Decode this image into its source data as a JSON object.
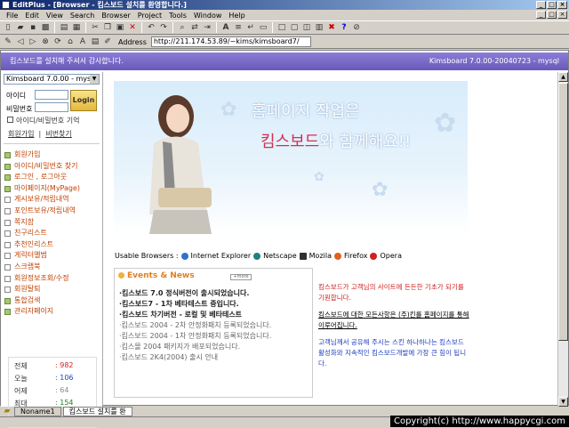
{
  "window": {
    "title": "EditPlus - [Browser - 킴스보드 설치를 환영합니다.]"
  },
  "menu": [
    "File",
    "Edit",
    "View",
    "Search",
    "Browser",
    "Project",
    "Tools",
    "Window",
    "Help"
  ],
  "address": {
    "label": "Address",
    "url": "http://211.174.53.89/~kims/kimsboard7/"
  },
  "topbar": {
    "left": "킴스보드를 설치해 주셔서 감사합니다.",
    "right": "Kimsboard 7.0.00-20040723 - mysql"
  },
  "login": {
    "select": "Kimsboard 7.0.00 - mysql",
    "id_label": "아이디",
    "pw_label": "비밀번호",
    "button": "Login",
    "remember": "아이디/비밀번호 기억",
    "join": "회원가입",
    "find": "비번찾기"
  },
  "nav": [
    {
      "label": "회원가입",
      "sub": false
    },
    {
      "label": "아이디/비밀번호 찾기",
      "sub": false
    },
    {
      "label": "로그인 , 로그아웃",
      "sub": false
    },
    {
      "label": "마이페이지(MyPage)",
      "sub": false
    },
    {
      "label": "게시보유/적립내역",
      "sub": true
    },
    {
      "label": "포인트보유/적립내역",
      "sub": true
    },
    {
      "label": "쪽지함",
      "sub": true
    },
    {
      "label": "친구리스트",
      "sub": true
    },
    {
      "label": "추천인리스트",
      "sub": true
    },
    {
      "label": "게릭터앨범",
      "sub": true
    },
    {
      "label": "스크랩북",
      "sub": true
    },
    {
      "label": "회원정보조회/수정",
      "sub": true
    },
    {
      "label": "회원탈퇴",
      "sub": true
    },
    {
      "label": "통합검색",
      "sub": false
    },
    {
      "label": "관리자페이지",
      "sub": false
    }
  ],
  "stats": [
    {
      "label": "전체",
      "value": ": 982",
      "color": "#d02020"
    },
    {
      "label": "오늘",
      "value": ": 106",
      "color": "#2040c0"
    },
    {
      "label": "어제",
      "value": ": 64",
      "color": "#888888"
    },
    {
      "label": "최대",
      "value": ": 154",
      "color": "#208020"
    }
  ],
  "banner": {
    "line1": "홈페이지 작업은",
    "line2_red": "킴스보드",
    "line2_rest": "와 함께해요!!"
  },
  "browsers": {
    "label": "Usable Browsers :",
    "items": [
      "Internet Explorer",
      "Netscape",
      "Mozila",
      "Firefox",
      "Opera"
    ]
  },
  "events": {
    "title": "Events & News",
    "more": "+more",
    "items": [
      {
        "text": "·킴스보드 7.0 정식버전이 출시되었습니다.",
        "style": "bold"
      },
      {
        "text": "·킴스보드7 - 1차 베타테스트 중입니다.",
        "style": "bold"
      },
      {
        "text": "·킴스보드 차기버전 - 로컬 및 베타테스트",
        "style": "bold"
      },
      {
        "text": "·킴스보드 2004 - 2차 안정화패치 등록되었습니다.",
        "style": "light"
      },
      {
        "text": "·킴스보드 2004 - 1차 안정화패치 등록되었습니다.",
        "style": "light"
      },
      {
        "text": "·킴스몰 2004 패키지가 배포되었습니다.",
        "style": "light"
      },
      {
        "text": "·킴스보드 2K4(2004) 출시 안내",
        "style": "light"
      }
    ]
  },
  "side": {
    "p1": "킴스보드가 고객님의 사이트에 든든한 기초가 되기를 기원합니다.",
    "p2": "킴스보드에 대한 모든사항은 (주)킨를 홈페이지를 통해 이루어집니다.",
    "p3": "고객님께서 공유해 주시는 스킨 하나하나는 킴스보드 활성화와 지속적인 킴스보드개발에 가장 큰 힘이 됩니다."
  },
  "tabs": [
    "Noname1",
    "킴스보드 설치를 환"
  ],
  "copyright": "Copyright(c) http://www.happycgi.com"
}
